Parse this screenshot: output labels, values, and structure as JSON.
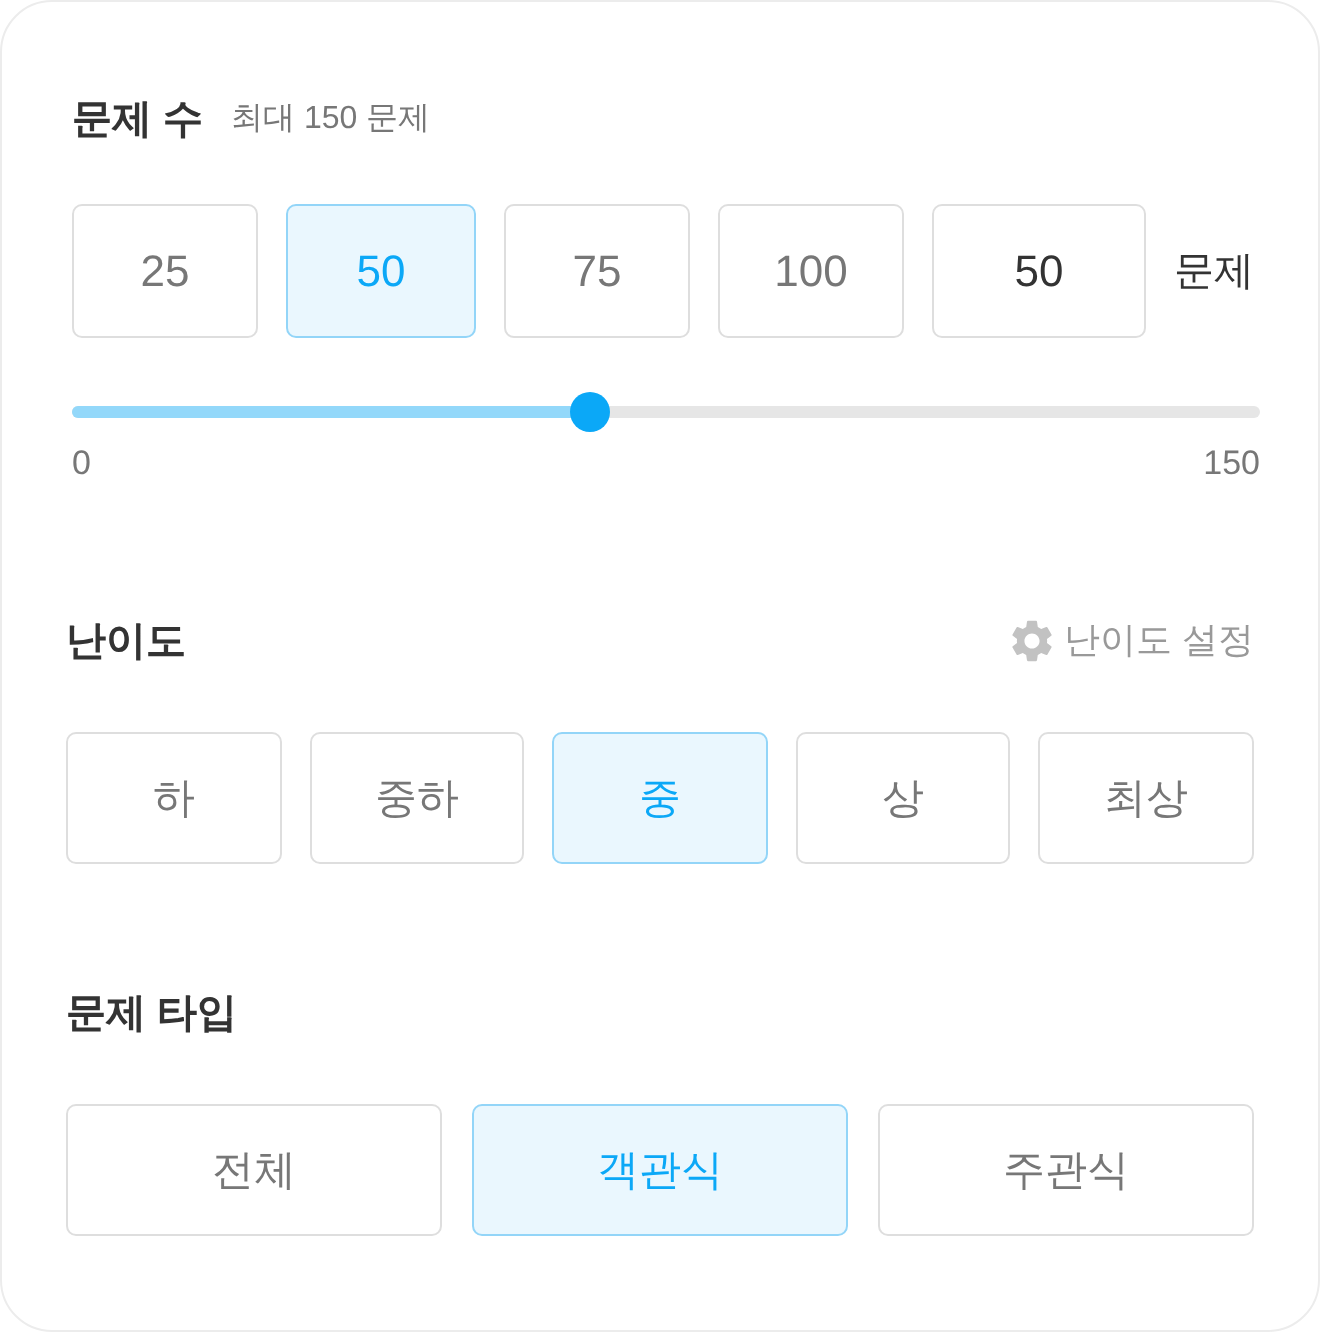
{
  "question_count": {
    "title": "문제 수",
    "subtitle": "최대 150 문제",
    "options": [
      {
        "label": "25",
        "selected": false
      },
      {
        "label": "50",
        "selected": true
      },
      {
        "label": "75",
        "selected": false
      },
      {
        "label": "100",
        "selected": false
      }
    ],
    "custom_input": {
      "value": "50"
    },
    "unit": "문제",
    "slider": {
      "level": 0.436,
      "min_label": "0",
      "max_label": "150"
    }
  },
  "difficulty": {
    "title": "난이도",
    "settings_link": "난이도 설정",
    "options": [
      {
        "label": "하",
        "selected": false
      },
      {
        "label": "중하",
        "selected": false
      },
      {
        "label": "중",
        "selected": true
      },
      {
        "label": "상",
        "selected": false
      },
      {
        "label": "최상",
        "selected": false
      }
    ]
  },
  "question_type": {
    "title": "문제 타입",
    "options": [
      {
        "label": "전체",
        "selected": false
      },
      {
        "label": "객관식",
        "selected": true
      },
      {
        "label": "주관식",
        "selected": false
      }
    ]
  }
}
